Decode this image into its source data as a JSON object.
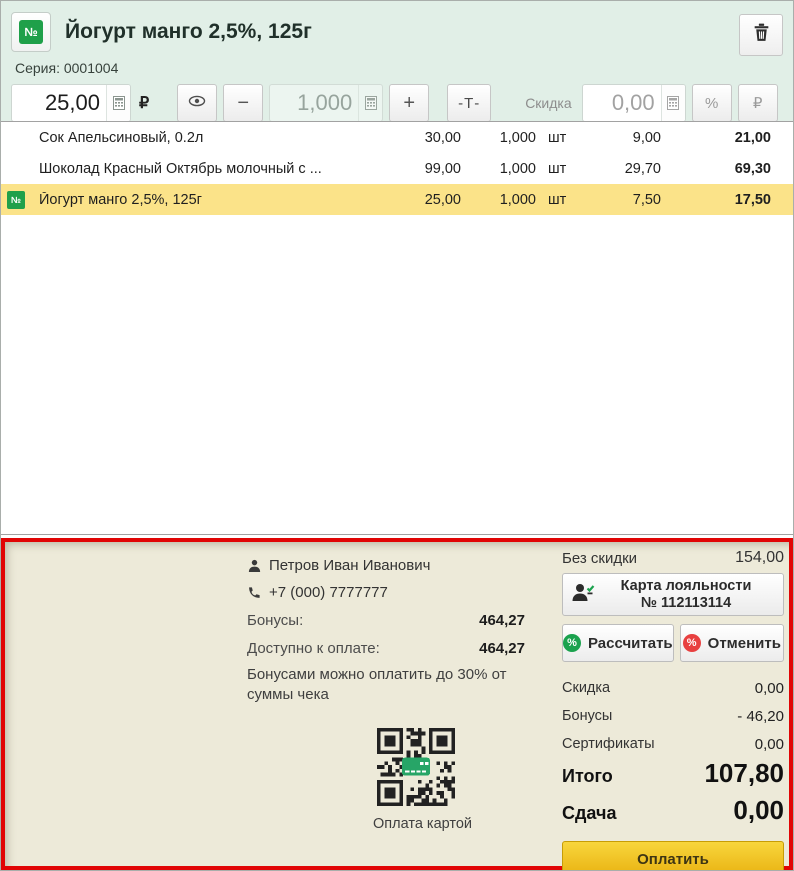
{
  "header": {
    "badge": "№",
    "title": "Йогурт манго 2,5%, 125г",
    "series": "Серия: 0001004",
    "price_value": "25,00",
    "currency": "₽",
    "minus": "−",
    "qty_value": "1,000",
    "plus": "+",
    "text_tool": "-Т-",
    "discount_label": "Скидка",
    "discount_value": "0,00",
    "percent_btn": "%",
    "ruble_btn": "₽"
  },
  "table": {
    "rows": [
      {
        "badge": "",
        "name": "Сок Апельсиновый, 0.2л",
        "price": "30,00",
        "qty": "1,000",
        "unit": "шт",
        "bonus": "9,00",
        "total": "21,00"
      },
      {
        "badge": "",
        "name": "Шоколад Красный Октябрь молочный с ...",
        "price": "99,00",
        "qty": "1,000",
        "unit": "шт",
        "bonus": "29,70",
        "total": "69,30"
      },
      {
        "badge": "№",
        "name": "Йогурт манго 2,5%, 125г",
        "price": "25,00",
        "qty": "1,000",
        "unit": "шт",
        "bonus": "7,50",
        "total": "17,50"
      }
    ]
  },
  "footer": {
    "customer": {
      "name": "Петров Иван Иванович",
      "phone": "+7 (000) 7777777",
      "bonus_label": "Бонусы:",
      "bonus_value": "464,27",
      "available_label": "Доступно к оплате:",
      "available_value": "464,27",
      "note": "Бонусами можно оплатить до 30% от суммы чека"
    },
    "qr_caption": "Оплата картой",
    "right": {
      "no_discount_label": "Без скидки",
      "no_discount_value": "154,00",
      "loyalty_line1": "Карта лояльности",
      "loyalty_line2": "№ 112113114",
      "calc_label": "Рассчитать",
      "cancel_label": "Отменить",
      "pct": "%",
      "rows": [
        {
          "label": "Скидка",
          "value": "0,00"
        },
        {
          "label": "Бонусы",
          "value": "- 46,20"
        },
        {
          "label": "Сертификаты",
          "value": "0,00"
        }
      ],
      "total_label": "Итого",
      "total_value": "107,80",
      "change_label": "Сдача",
      "change_value": "0,00",
      "pay_label": "Оплатить"
    }
  },
  "icons": {
    "number_badge": "№",
    "trash": "trash-can",
    "eye": "eye",
    "calculator": "calculator-grid",
    "person": "person-silhouette",
    "phone": "phone-handset",
    "person_check": "person-with-checkmark",
    "percent_green": "percent-circle-green",
    "percent_red": "percent-circle-red",
    "qr": "qr-code-with-card"
  },
  "colors": {
    "header_bg": "#e1efe7",
    "accent_green": "#1fa04a",
    "row_highlight": "#fbe389",
    "panel_bg": "#edead9",
    "panel_border": "#e10505",
    "pay_gold": "#eab411"
  }
}
